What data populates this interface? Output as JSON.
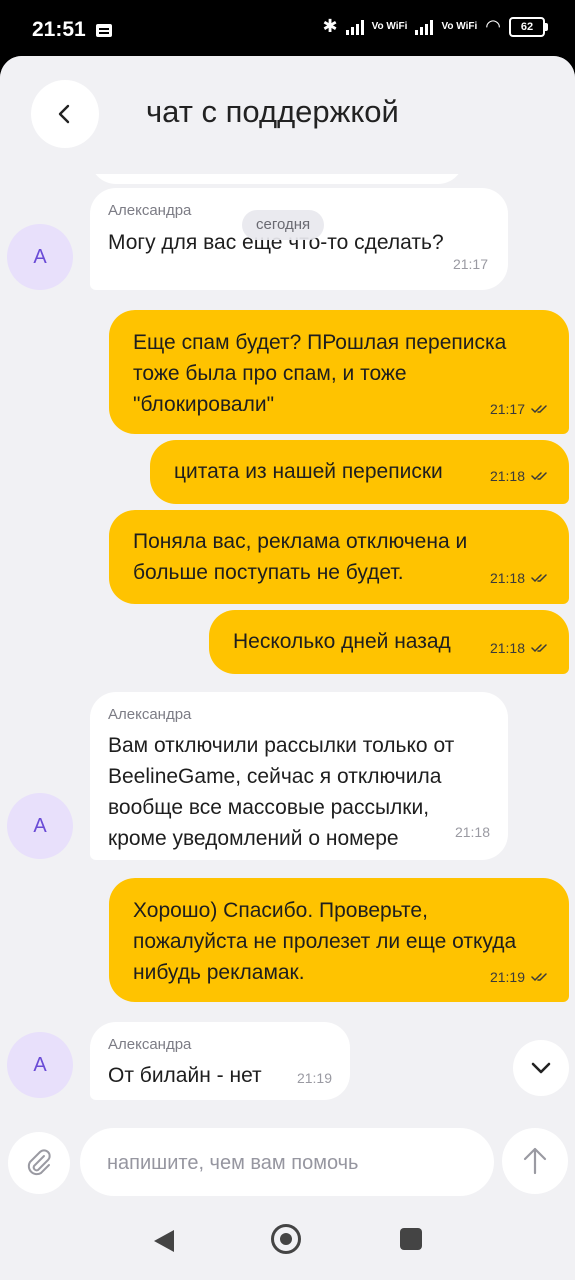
{
  "status_bar": {
    "time": "21:51",
    "net_label_1": "Vo WiFi",
    "net_label_2": "Vo WiFi",
    "battery": "62"
  },
  "header": {
    "title": "чат с поддержкой"
  },
  "date_divider": "сегодня",
  "messages": [
    {
      "dir": "in",
      "sender": "Александра",
      "lines": [
        "Могу для вас еще что-то сделать?"
      ],
      "time": "21:17"
    },
    {
      "dir": "out",
      "lines": [
        "Еще спам будет? ПРошлая переписка",
        "тоже была про спам, и тоже",
        "\"блокировали\""
      ],
      "time": "21:17",
      "read": true
    },
    {
      "dir": "out",
      "lines": [
        "цитата из нашей переписки"
      ],
      "time": "21:18",
      "read": true
    },
    {
      "dir": "out",
      "lines": [
        "Поняла вас, реклама отключена и",
        "больше поступать не будет."
      ],
      "time": "21:18",
      "read": true
    },
    {
      "dir": "out",
      "lines": [
        "Несколько дней назад"
      ],
      "time": "21:18",
      "read": true
    },
    {
      "dir": "in",
      "sender": "Александра",
      "lines": [
        "Вам отключили рассылки только от",
        "BeelineGame, сейчас я отключила",
        "вообще все массовые рассылки,",
        "кроме уведомлений о номере"
      ],
      "time": "21:18"
    },
    {
      "dir": "out",
      "lines": [
        "Хорошо) Спасибо. Проверьте,",
        "пожалуйста не пролезет ли еще откуда",
        "нибудь рекламак."
      ],
      "time": "21:19",
      "read": true
    },
    {
      "dir": "in",
      "sender": "Александра",
      "lines": [
        "От билайн - нет"
      ],
      "time": "21:19"
    }
  ],
  "avatars": [
    "А",
    "А",
    "А"
  ],
  "composer": {
    "placeholder": "напишите, чем вам помочь"
  },
  "icons": {
    "back": "chevron-left-icon",
    "attach": "paperclip-icon",
    "send": "arrow-up-icon",
    "scroll_down": "chevron-down-icon",
    "read": "double-check-icon"
  },
  "colors": {
    "outgoing_bubble": "#ffc300",
    "incoming_bubble": "#ffffff",
    "background": "#f1f1f4",
    "avatar_bg": "#e8e0fb",
    "avatar_text": "#6a4bd6"
  }
}
